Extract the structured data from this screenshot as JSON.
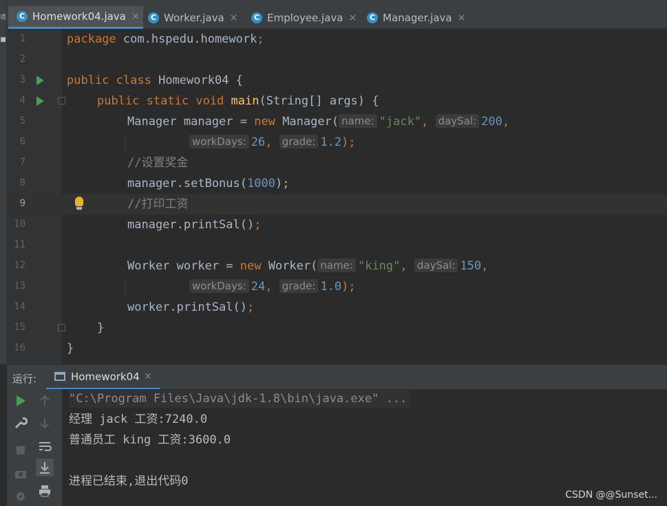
{
  "left_strip": {
    "glyphs": [
      "项",
      "■"
    ]
  },
  "tabs": [
    {
      "label": "Homework04.java",
      "active": true,
      "icon": "java-class-icon",
      "close": "×"
    },
    {
      "label": "Worker.java",
      "active": false,
      "icon": "java-class-icon",
      "close": "×"
    },
    {
      "label": "Employee.java",
      "active": false,
      "icon": "java-class-icon",
      "close": "×"
    },
    {
      "label": "Manager.java",
      "active": false,
      "icon": "java-class-icon",
      "close": "×"
    }
  ],
  "tab_icon_letter": "C",
  "code": {
    "line_numbers": [
      "1",
      "2",
      "3",
      "4",
      "5",
      "6",
      "7",
      "8",
      "9",
      "10",
      "11",
      "12",
      "13",
      "14",
      "15",
      "16"
    ],
    "l1": {
      "kw": "package",
      "rest": " com.hspedu.homework",
      "semi": ";"
    },
    "l3": {
      "kw1": "public",
      "kw2": "class",
      "name": " Homework04 {"
    },
    "l4": {
      "kw1": "public",
      "kw2": "static",
      "kw3": "void",
      "fn": "main",
      "rest": "(String[] args) {"
    },
    "l5": {
      "pre": "Manager manager = ",
      "kw": "new",
      "cls": " Manager(",
      "hint_name": "name:",
      "str": "\"jack\"",
      "comma1": ", ",
      "hint_daysal": "daySal:",
      "num": "200",
      "comma2": ","
    },
    "l6": {
      "hint_workdays": "workDays:",
      "num1": "26",
      "comma": ", ",
      "hint_grade": "grade:",
      "num2": "1.2",
      "tail": ");"
    },
    "l7": {
      "comment": "//设置奖金"
    },
    "l8": {
      "pre": "manager.setBonus(",
      "num": "1000",
      "tail": ");"
    },
    "l9": {
      "comment": "//打印工资"
    },
    "l10": {
      "pre": "manager.printSal()",
      "tail": ";"
    },
    "l12": {
      "pre": "Worker worker = ",
      "kw": "new",
      "cls": " Worker(",
      "hint_name": "name:",
      "str": "\"king\"",
      "comma1": ", ",
      "hint_daysal": "daySal:",
      "num": "150",
      "comma2": ","
    },
    "l13": {
      "hint_workdays": "workDays:",
      "num1": "24",
      "comma": ", ",
      "hint_grade": "grade:",
      "num2": "1.0",
      "tail": ");"
    },
    "l14": {
      "pre": "worker.printSal()",
      "tail": ";"
    },
    "l15": {
      "text": "}"
    },
    "l16": {
      "text": "}"
    }
  },
  "run_panel": {
    "label": "运行:",
    "tab_label": "Homework04",
    "tab_close": "×",
    "output": [
      "\"C:\\Program Files\\Java\\jdk-1.8\\bin\\java.exe\" ...",
      "经理 jack 工资:7240.0",
      "普通员工 king 工资:3600.0",
      "",
      "进程已结束,退出代码0"
    ]
  },
  "watermark": "CSDN @@Sunset...",
  "colors": {
    "keyword": "#cc7832",
    "function": "#ffc66d",
    "number": "#6897bb",
    "string": "#6a8759",
    "comment": "#808080",
    "run_green": "#499c54",
    "accent_blue": "#4a88c7"
  }
}
